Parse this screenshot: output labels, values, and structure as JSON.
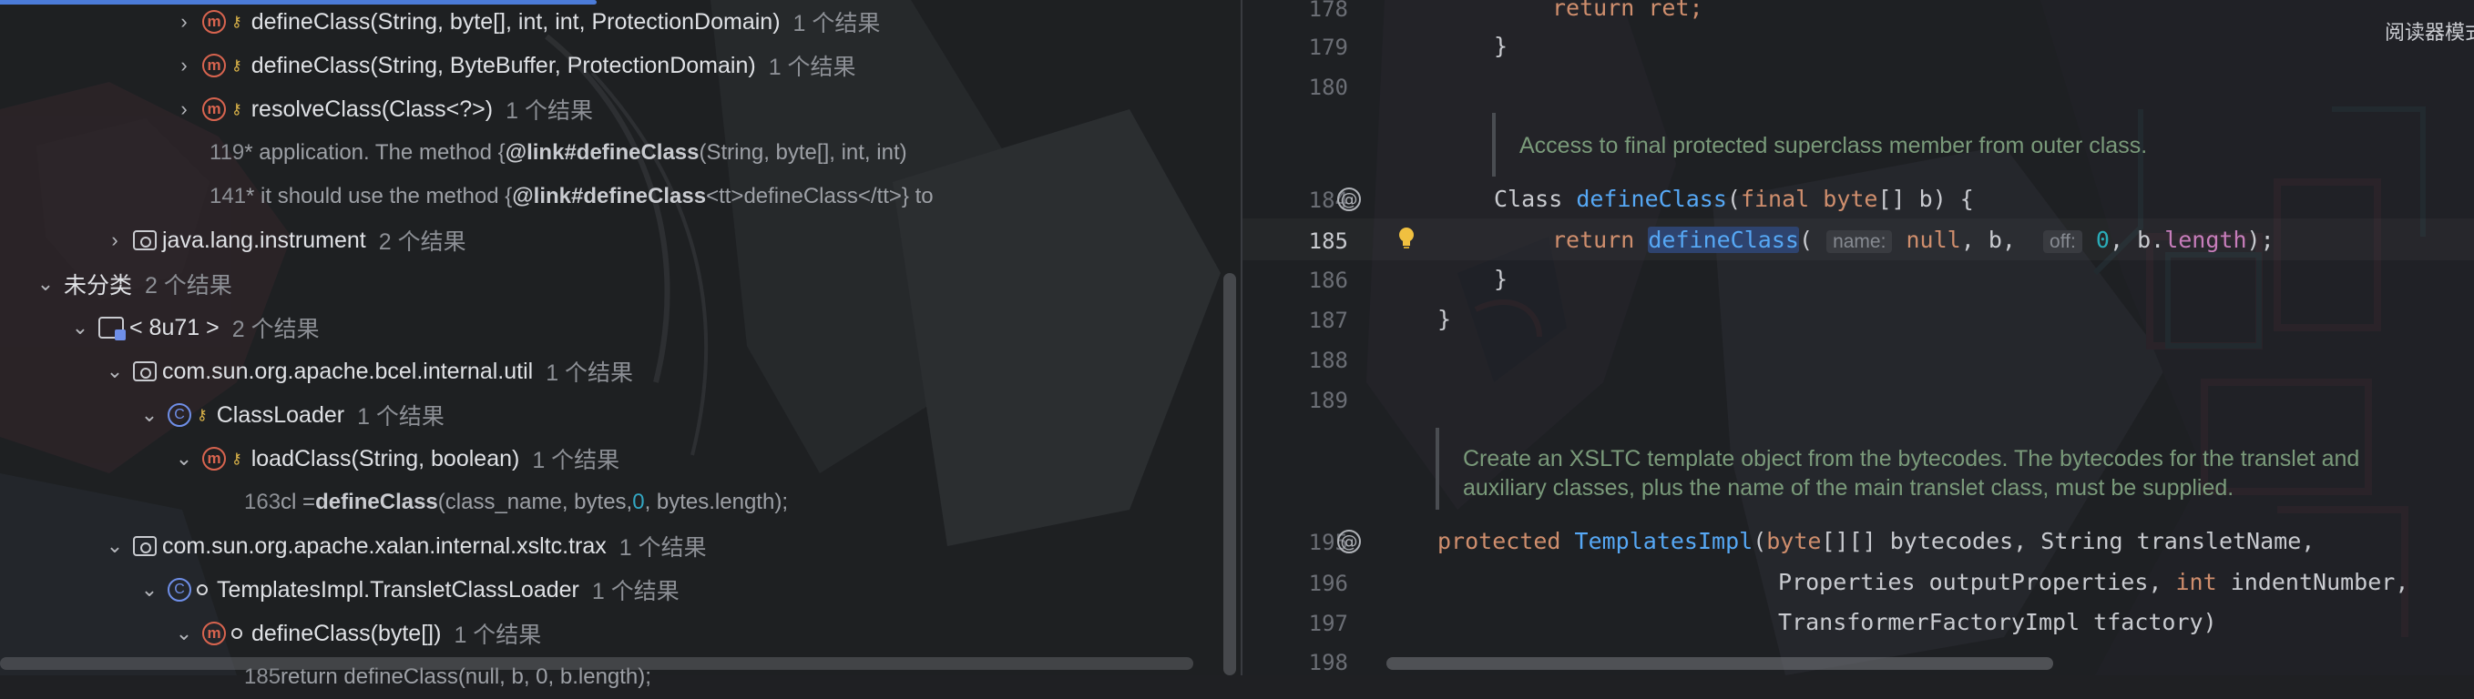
{
  "usages_tree": {
    "rows": [
      {
        "kind": "method",
        "label": "defineClass(String, byte[], int, int, ProtectionDomain)",
        "count": "1 个结果"
      },
      {
        "kind": "method",
        "label": "defineClass(String, ByteBuffer, ProtectionDomain)",
        "count": "1 个结果"
      },
      {
        "kind": "method",
        "label": "resolveClass(Class<?>)",
        "count": "1 个结果"
      },
      {
        "kind": "snippet",
        "line": "119",
        "text": " * application.  The method {",
        "tag": "@link",
        "bold": " #defineClass",
        "tail": "(String, byte[], int, int)"
      },
      {
        "kind": "snippet",
        "line": "141",
        "text": " * it should use the method {",
        "tag": "@link",
        "bold": " #defineClass",
        "tail": " <tt>defineClass</tt>} to"
      },
      {
        "kind": "package",
        "label": "java.lang.instrument",
        "count": "2 个结果"
      },
      {
        "kind": "group",
        "label": "未分类",
        "count": "2 个结果"
      },
      {
        "kind": "module",
        "label": "< 8u71 >",
        "count": "2 个结果"
      },
      {
        "kind": "package",
        "label": "com.sun.org.apache.bcel.internal.util",
        "count": "1 个结果"
      },
      {
        "kind": "class",
        "label": "ClassLoader",
        "count": "1 个结果"
      },
      {
        "kind": "method",
        "label": "loadClass(String, boolean)",
        "count": "1 个结果"
      },
      {
        "kind": "snippet2",
        "line": "163",
        "pre": " cl = ",
        "bold": "defineClass",
        "mid": "(class_name, bytes, ",
        "num": "0",
        "tail": ", bytes.length);"
      },
      {
        "kind": "package",
        "label": "com.sun.org.apache.xalan.internal.xsltc.trax",
        "count": "1 个结果"
      },
      {
        "kind": "class",
        "label": "TemplatesImpl.TransletClassLoader",
        "count": "1 个结果"
      },
      {
        "kind": "method",
        "label": "defineClass(byte[])",
        "count": "1 个结果"
      },
      {
        "kind": "snippet3",
        "line": "185",
        "text": "return defineClass(null, b, 0, b.length);"
      }
    ]
  },
  "editor": {
    "reader_mode": "阅读器模式",
    "lines": {
      "l178": "178",
      "l179": "179",
      "l180": "180",
      "l184": "184",
      "l185": "185",
      "l186": "186",
      "l187": "187",
      "l188": "188",
      "l189": "189",
      "l195": "195",
      "l196": "196",
      "l197": "197",
      "l198": "198"
    },
    "code": {
      "c178": "return ret;",
      "c179": "}",
      "doc1": "Access to final protected superclass member from outer class.",
      "c184_type": "Class ",
      "c184_fn": "defineClass",
      "c184_open": "(",
      "c184_final": "final ",
      "c184_byte": "byte",
      "c184_rest": "[] b) {",
      "c185_ret": "return ",
      "c185_fn": "defineClass",
      "c185_open": "(",
      "hint_name": "name:",
      "c185_null": "null",
      "c185_mid": ", b, ",
      "hint_off": "off:",
      "c185_zero": "0",
      "c185_b": ", b.",
      "c185_len": "length",
      "c185_end": ");",
      "c186": "}",
      "c187": "}",
      "doc2_l1": "Create an XSLTC template object from the bytecodes. The bytecodes for the translet and",
      "doc2_l2": "auxiliary classes, plus the name of the main translet class, must be supplied.",
      "c195_prot": "protected ",
      "c195_fn": "TemplatesImpl",
      "c195_open": "(",
      "c195_byte": "byte",
      "c195_rest": "[][] bytecodes, String transletName,",
      "c196_a": "Properties outputProperties, ",
      "c196_int": "int",
      "c196_b": " indentNumber,",
      "c197": "TransformerFactoryImpl tfactory)"
    }
  }
}
